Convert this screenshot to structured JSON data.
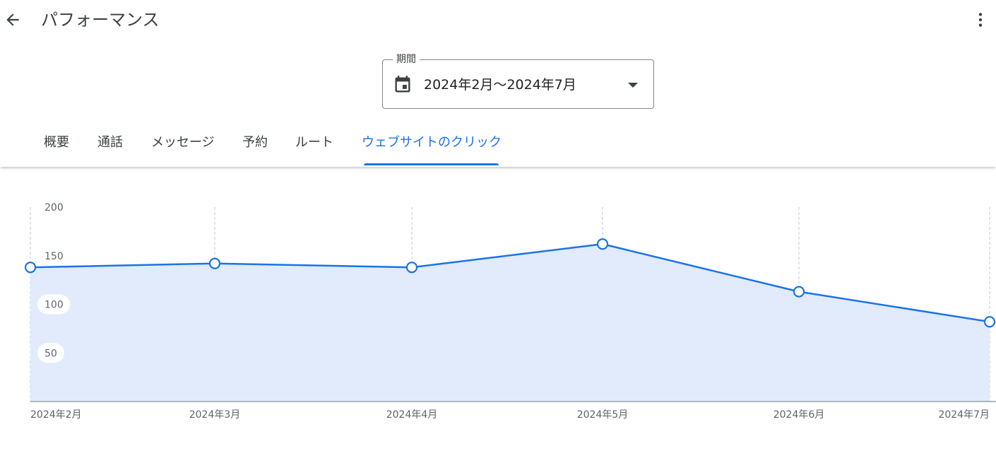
{
  "header": {
    "title": "パフォーマンス",
    "back_icon": "arrow-left-icon",
    "more_icon": "more-vert-icon"
  },
  "period": {
    "label": "期間",
    "value": "2024年2月～2024年7月",
    "icon": "calendar-icon",
    "dropdown_icon": "caret-down-icon"
  },
  "tabs": [
    {
      "label": "概要",
      "active": false
    },
    {
      "label": "通話",
      "active": false
    },
    {
      "label": "メッセージ",
      "active": false
    },
    {
      "label": "予約",
      "active": false
    },
    {
      "label": "ルート",
      "active": false
    },
    {
      "label": "ウェブサイトのクリック",
      "active": true
    }
  ],
  "colors": {
    "accent": "#1a73e8",
    "area_fill": "#e1ebfc",
    "text_primary": "#202124",
    "text_secondary": "#5f6368"
  },
  "chart_data": {
    "type": "area",
    "categories": [
      "2024年2月",
      "2024年3月",
      "2024年4月",
      "2024年5月",
      "2024年6月",
      "2024年7月"
    ],
    "values": [
      138,
      142,
      138,
      162,
      113,
      82
    ],
    "y_ticks": [
      "50",
      "100",
      "150",
      "200"
    ],
    "ylim": [
      0,
      200
    ],
    "grid": "vertical-dashed"
  }
}
